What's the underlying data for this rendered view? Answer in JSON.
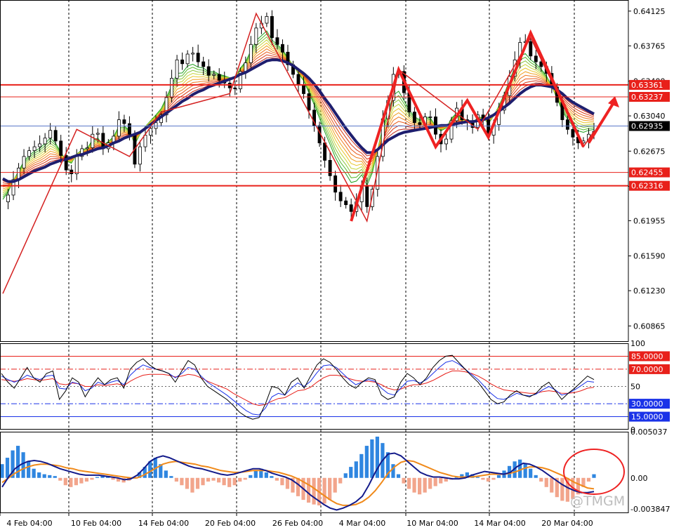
{
  "chart_data": {
    "type": "line",
    "price_panel": {
      "y_ticks": [
        "0.64125",
        "0.63765",
        "0.63400",
        "0.63040",
        "0.62675",
        "0.62310",
        "0.61955",
        "0.61590",
        "0.61230",
        "0.60865"
      ],
      "ylim": [
        0.607,
        0.6424
      ],
      "current_price": "0.62935",
      "levels": [
        {
          "label": "0.63361",
          "value": 0.63361,
          "color": "#e8201a",
          "width": 2
        },
        {
          "label": "0.63237",
          "value": 0.63237,
          "color": "#e8201a",
          "width": 1
        },
        {
          "label": "0.62455",
          "value": 0.62455,
          "color": "#e8201a",
          "width": 1
        },
        {
          "label": "0.62316",
          "value": 0.62316,
          "color": "#e8201a",
          "width": 2
        }
      ],
      "close_series": [
        0.6215,
        0.6222,
        0.6238,
        0.625,
        0.6262,
        0.6268,
        0.6272,
        0.6275,
        0.6281,
        0.6289,
        0.6278,
        0.6263,
        0.6248,
        0.6244,
        0.6262,
        0.627,
        0.6271,
        0.6285,
        0.6286,
        0.627,
        0.6276,
        0.6283,
        0.63,
        0.6296,
        0.6285,
        0.6254,
        0.6272,
        0.6284,
        0.6291,
        0.6297,
        0.6305,
        0.6323,
        0.6343,
        0.6362,
        0.6358,
        0.6368,
        0.6369,
        0.636,
        0.6355,
        0.6346,
        0.6347,
        0.6341,
        0.6338,
        0.6333,
        0.6332,
        0.635,
        0.6359,
        0.6378,
        0.6395,
        0.64,
        0.6407,
        0.6385,
        0.6378,
        0.637,
        0.6357,
        0.6347,
        0.6336,
        0.6327,
        0.631,
        0.6294,
        0.6276,
        0.6258,
        0.6242,
        0.6225,
        0.6216,
        0.6212,
        0.6205,
        0.6215,
        0.6232,
        0.621,
        0.6228,
        0.6262,
        0.6301,
        0.632,
        0.6347,
        0.635,
        0.6328,
        0.6308,
        0.6297,
        0.6295,
        0.6303,
        0.6303,
        0.6285,
        0.6275,
        0.628,
        0.6299,
        0.6312,
        0.63,
        0.6298,
        0.6292,
        0.6305,
        0.63,
        0.6284,
        0.6295,
        0.631,
        0.6325,
        0.6345,
        0.6362,
        0.638,
        0.6381,
        0.6366,
        0.636,
        0.6355,
        0.6348,
        0.6334,
        0.6318,
        0.63,
        0.629,
        0.6282,
        0.6276,
        0.6278,
        0.6285,
        0.6288
      ],
      "fast_ma": [
        0.622,
        0.6228,
        0.6236,
        0.6244,
        0.6252,
        0.6258,
        0.6263,
        0.6266,
        0.627,
        0.6273,
        0.6273,
        0.627,
        0.6267,
        0.6266,
        0.6267,
        0.6268,
        0.627,
        0.6273,
        0.6276,
        0.6277,
        0.6279,
        0.6282,
        0.6287,
        0.6291,
        0.6293,
        0.6295,
        0.6298,
        0.6302,
        0.6307,
        0.6313,
        0.6318,
        0.6323,
        0.6328,
        0.6334,
        0.6339,
        0.6343,
        0.6346,
        0.6349,
        0.6352,
        0.6353,
        0.6353,
        0.6353,
        0.6353,
        0.6354,
        0.6355,
        0.6357,
        0.6361,
        0.6365,
        0.6369,
        0.6374,
        0.6377,
        0.638,
        0.6378,
        0.6375,
        0.6371,
        0.6366,
        0.636,
        0.6354,
        0.6346,
        0.6337,
        0.6327,
        0.6317,
        0.6307,
        0.6297,
        0.6286,
        0.6276,
        0.6265,
        0.6258,
        0.6254,
        0.6254,
        0.6262,
        0.6275,
        0.6285,
        0.6296,
        0.6304,
        0.6309,
        0.6312,
        0.6312,
        0.6309,
        0.6305,
        0.6303,
        0.6301,
        0.6301,
        0.6302,
        0.6303,
        0.6304,
        0.6302,
        0.6301,
        0.63,
        0.63,
        0.6301,
        0.6304,
        0.6308,
        0.6313,
        0.6319,
        0.6328,
        0.6337,
        0.6346,
        0.6352,
        0.6356,
        0.6358,
        0.6356,
        0.635,
        0.6343,
        0.6335,
        0.6326,
        0.6318,
        0.6311,
        0.6305,
        0.6301,
        0.6296,
        0.6293,
        0.6292
      ],
      "slow_ma": [
        0.6239,
        0.6236,
        0.6236,
        0.6238,
        0.6241,
        0.6244,
        0.6247,
        0.6249,
        0.6251,
        0.6254,
        0.6256,
        0.6258,
        0.6259,
        0.6261,
        0.6263,
        0.6264,
        0.6266,
        0.6268,
        0.627,
        0.6271,
        0.6273,
        0.6276,
        0.6278,
        0.6281,
        0.6283,
        0.6285,
        0.6287,
        0.6291,
        0.6295,
        0.6299,
        0.6303,
        0.6307,
        0.6311,
        0.6315,
        0.6319,
        0.6322,
        0.6326,
        0.6329,
        0.6331,
        0.6334,
        0.6336,
        0.6338,
        0.634,
        0.6342,
        0.6344,
        0.6347,
        0.6349,
        0.6352,
        0.6355,
        0.6358,
        0.6361,
        0.6362,
        0.6362,
        0.6361,
        0.6359,
        0.6356,
        0.6352,
        0.6348,
        0.6343,
        0.6337,
        0.633,
        0.6322,
        0.6315,
        0.6307,
        0.6299,
        0.6291,
        0.6284,
        0.6277,
        0.6271,
        0.6266,
        0.6266,
        0.6269,
        0.6274,
        0.6279,
        0.6282,
        0.6285,
        0.6287,
        0.6288,
        0.6289,
        0.629,
        0.6291,
        0.6292,
        0.6293,
        0.6294,
        0.6294,
        0.6295,
        0.6296,
        0.6297,
        0.6298,
        0.6298,
        0.6299,
        0.63,
        0.6302,
        0.6305,
        0.6309,
        0.6313,
        0.6317,
        0.6322,
        0.6327,
        0.6331,
        0.6334,
        0.6336,
        0.6336,
        0.6335,
        0.6334,
        0.6331,
        0.6327,
        0.6322,
        0.6318,
        0.6315,
        0.6312,
        0.6309,
        0.6306
      ]
    },
    "oscillator_panel": {
      "ylim": [
        0,
        100
      ],
      "y_ticks": [
        "100",
        "50",
        "0"
      ],
      "levels": [
        {
          "label": "85.0000",
          "value": 85,
          "color": "#e8201a",
          "style": "solid"
        },
        {
          "label": "70.0000",
          "value": 70,
          "color": "#e8201a",
          "style": "dashdot"
        },
        {
          "label": "30.0000",
          "value": 30,
          "color": "#1a32e8",
          "style": "dashdot"
        },
        {
          "label": "15.0000",
          "value": 15,
          "color": "#1a32e8",
          "style": "solid"
        }
      ],
      "line_k": [
        65,
        55,
        48,
        60,
        72,
        60,
        55,
        65,
        68,
        35,
        45,
        60,
        55,
        38,
        50,
        60,
        52,
        58,
        60,
        48,
        70,
        78,
        82,
        75,
        70,
        68,
        65,
        55,
        68,
        80,
        75,
        60,
        50,
        45,
        40,
        35,
        28,
        20,
        15,
        12,
        14,
        30,
        50,
        48,
        40,
        55,
        60,
        48,
        62,
        75,
        82,
        78,
        70,
        60,
        52,
        48,
        55,
        60,
        58,
        40,
        35,
        38,
        55,
        65,
        60,
        52,
        60,
        72,
        80,
        85,
        86,
        78,
        70,
        62,
        55,
        45,
        35,
        30,
        32,
        40,
        45,
        40,
        38,
        42,
        50,
        55,
        45,
        35,
        42,
        48,
        55,
        62,
        58
      ],
      "line_d": [
        62,
        58,
        55,
        58,
        63,
        60,
        58,
        62,
        63,
        48,
        47,
        55,
        53,
        45,
        48,
        55,
        52,
        55,
        57,
        52,
        63,
        70,
        75,
        72,
        70,
        68,
        65,
        60,
        65,
        72,
        70,
        62,
        55,
        50,
        45,
        40,
        34,
        28,
        22,
        18,
        17,
        25,
        38,
        42,
        40,
        48,
        54,
        50,
        56,
        66,
        74,
        75,
        72,
        65,
        58,
        52,
        55,
        58,
        56,
        48,
        42,
        40,
        48,
        56,
        57,
        54,
        58,
        65,
        72,
        78,
        80,
        76,
        70,
        64,
        58,
        50,
        42,
        36,
        35,
        38,
        42,
        40,
        39,
        41,
        46,
        50,
        46,
        40,
        42,
        46,
        51,
        56,
        55
      ],
      "line_s": [
        58,
        57,
        56,
        57,
        59,
        58,
        57,
        58,
        59,
        53,
        52,
        54,
        53,
        50,
        50,
        52,
        51,
        52,
        53,
        51,
        56,
        60,
        63,
        64,
        64,
        64,
        63,
        61,
        62,
        64,
        63,
        60,
        56,
        53,
        50,
        47,
        42,
        38,
        34,
        30,
        28,
        29,
        33,
        36,
        37,
        41,
        45,
        46,
        49,
        55,
        60,
        63,
        63,
        62,
        59,
        57,
        56,
        56,
        55,
        52,
        48,
        46,
        47,
        50,
        52,
        52,
        54,
        57,
        61,
        65,
        68,
        68,
        67,
        65,
        62,
        58,
        53,
        49,
        46,
        45,
        44,
        43,
        42,
        42,
        44,
        45,
        44,
        42,
        42,
        43,
        45,
        48,
        49
      ]
    },
    "macd_panel": {
      "ylim": [
        -0.0038477,
        0.0050375
      ],
      "y_ticks": [
        "0.005037",
        "0.00",
        "-0.003847"
      ],
      "histogram": [
        0.0015,
        0.0022,
        0.003,
        0.0035,
        0.0028,
        0.0018,
        0.001,
        0.0006,
        0.0004,
        0.0003,
        0.0002,
        -0.0003,
        -0.0008,
        -0.001,
        -0.0008,
        -0.0006,
        -0.0004,
        -0.0002,
        0.0001,
        0.0003,
        0.0002,
        -0.0002,
        -0.0004,
        -0.0005,
        -0.0003,
        0.0,
        0.0006,
        0.0012,
        0.0018,
        0.0022,
        0.0015,
        0.0008,
        0.0002,
        -0.0004,
        -0.0008,
        -0.0012,
        -0.0016,
        -0.0012,
        -0.0008,
        -0.0004,
        -0.0003,
        -0.0005,
        -0.0008,
        -0.001,
        -0.0008,
        -0.0004,
        -0.0002,
        0.0003,
        0.0008,
        0.001,
        0.0006,
        0.0002,
        -0.0003,
        -0.0008,
        -0.0012,
        -0.0016,
        -0.002,
        -0.0024,
        -0.0027,
        -0.0029,
        -0.003,
        -0.0028,
        -0.0024,
        -0.0016,
        -0.0006,
        0.0005,
        0.0012,
        0.0018,
        0.0026,
        0.0035,
        0.0042,
        0.0045,
        0.0038,
        0.0028,
        0.0015,
        0.0004,
        -0.0006,
        -0.0012,
        -0.0016,
        -0.0018,
        -0.0016,
        -0.0012,
        -0.0009,
        -0.0006,
        -0.0004,
        -0.0002,
        0.0001,
        0.0004,
        0.0006,
        0.0004,
        0.0001,
        -0.0002,
        -0.0004,
        -0.0002,
        0.0003,
        0.0008,
        0.0013,
        0.0018,
        0.002,
        0.0016,
        0.001,
        0.0003,
        -0.0004,
        -0.001,
        -0.0016,
        -0.0021,
        -0.0025,
        -0.0026,
        -0.0023,
        -0.0018,
        -0.001,
        -0.0004,
        0.0004
      ],
      "macd_line": [
        -0.001,
        0.0001,
        0.001,
        0.0015,
        0.0018,
        0.0019,
        0.0018,
        0.0016,
        0.0013,
        0.001,
        0.0008,
        0.0006,
        0.0004,
        0.0003,
        0.0003,
        0.0003,
        0.0002,
        0.0001,
        0.0,
        -0.0002,
        -0.0001,
        0.0003,
        0.001,
        0.0018,
        0.0022,
        0.0024,
        0.0022,
        0.0019,
        0.0016,
        0.0013,
        0.0011,
        0.001,
        0.0008,
        0.0006,
        0.0004,
        0.0003,
        0.0004,
        0.0006,
        0.0008,
        0.001,
        0.001,
        0.0008,
        0.0005,
        0.0003,
        0.0001,
        -0.0002,
        -0.0007,
        -0.0013,
        -0.0019,
        -0.0024,
        -0.0029,
        -0.0033,
        -0.0035,
        -0.0033,
        -0.003,
        -0.0026,
        -0.002,
        -0.0008,
        0.0006,
        0.0018,
        0.0026,
        0.0027,
        0.0024,
        0.0018,
        0.0012,
        0.0006,
        0.0003,
        0.0001,
        0.0001,
        0.0,
        -0.0001,
        -0.0001,
        0.0,
        0.0003,
        0.0005,
        0.0007,
        0.0006,
        0.0005,
        0.0004,
        0.0006,
        0.0012,
        0.0016,
        0.0015,
        0.0012,
        0.0008,
        0.0003,
        -0.0002,
        -0.0007,
        -0.0011,
        -0.0014,
        -0.0016,
        -0.0016,
        -0.0015
      ],
      "signal_line": [
        -0.0005,
        0.0,
        0.0005,
        0.0009,
        0.0012,
        0.0014,
        0.0015,
        0.0015,
        0.0014,
        0.0013,
        0.0011,
        0.001,
        0.0008,
        0.0007,
        0.0006,
        0.0005,
        0.0004,
        0.0003,
        0.0002,
        0.0001,
        0.0,
        0.0,
        0.0003,
        0.0007,
        0.0011,
        0.0015,
        0.0017,
        0.0018,
        0.0017,
        0.0016,
        0.0015,
        0.0013,
        0.0012,
        0.001,
        0.0008,
        0.0007,
        0.0006,
        0.0006,
        0.0007,
        0.0008,
        0.0008,
        0.0008,
        0.0007,
        0.0006,
        0.0004,
        0.0002,
        -0.0001,
        -0.0005,
        -0.0009,
        -0.0014,
        -0.0019,
        -0.0024,
        -0.0028,
        -0.003,
        -0.003,
        -0.0029,
        -0.0026,
        -0.0021,
        -0.0014,
        -0.0005,
        0.0005,
        0.0012,
        0.0017,
        0.0019,
        0.0018,
        0.0015,
        0.0012,
        0.0009,
        0.0006,
        0.0004,
        0.0002,
        0.0001,
        0.0001,
        0.0001,
        0.0002,
        0.0003,
        0.0004,
        0.0004,
        0.0004,
        0.0005,
        0.0007,
        0.001,
        0.0012,
        0.0012,
        0.0011,
        0.0009,
        0.0006,
        0.0003,
        -0.0001,
        -0.0005,
        -0.0008,
        -0.0011,
        -0.0012
      ]
    },
    "x_labels": [
      "4 Feb 04:00",
      "10 Feb 04:00",
      "14 Feb 04:00",
      "20 Feb 04:00",
      "26 Feb 04:00",
      "4 Mar 04:00",
      "10 Mar 04:00",
      "14 Mar 04:00",
      "20 Mar 04:00"
    ],
    "colors": {
      "bull_hist": "#2f86e0",
      "bear_hist": "#f2a58c",
      "macd": "#131a8a",
      "signal": "#f08a1a",
      "slow_ma": "#1e1e6e",
      "osc_k": "#000000",
      "osc_d": "#1a32e8",
      "osc_s": "#e8201a",
      "annotation": "#ee2222",
      "current_tag": "#000000"
    }
  },
  "watermark": "@TMGM"
}
